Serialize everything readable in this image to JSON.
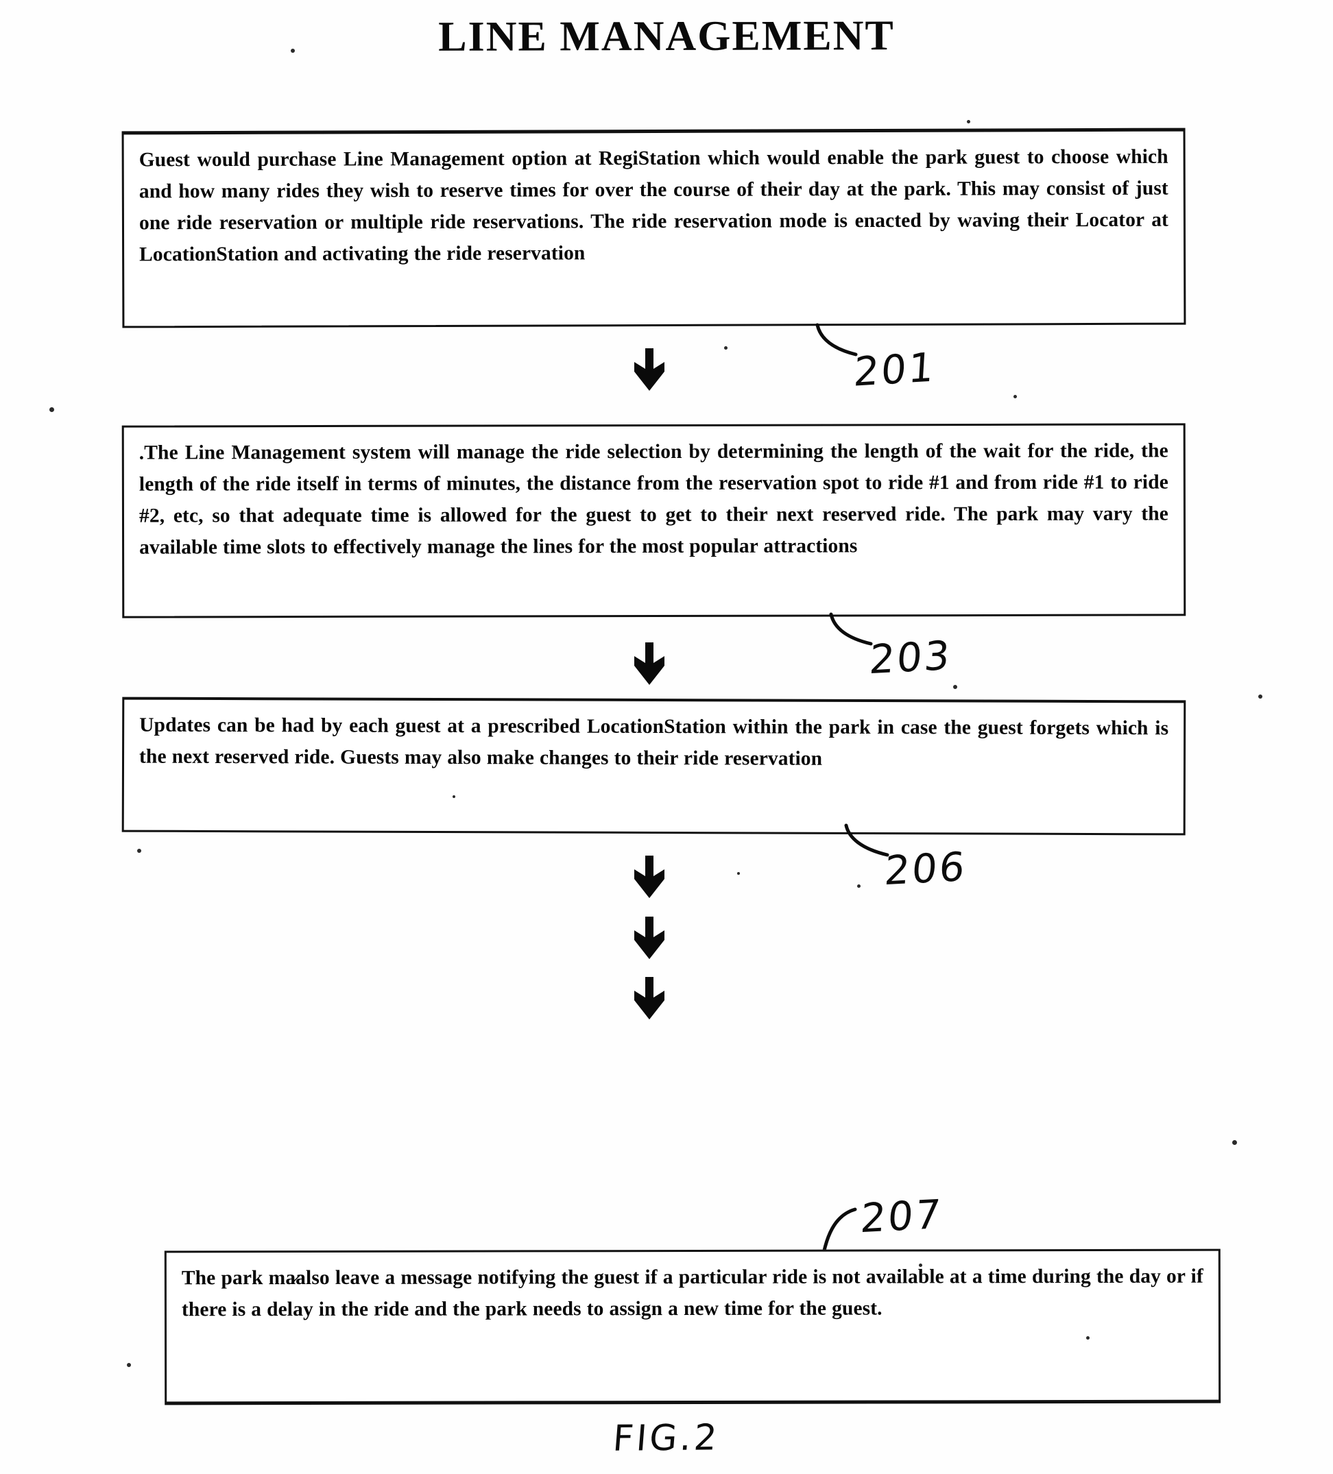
{
  "document": {
    "title": "LINE MANAGEMENT",
    "figure_caption": "FIG.2",
    "type": "patent-flowchart"
  },
  "flow": {
    "steps": [
      {
        "ref": "201",
        "text": "Guest would purchase Line Management option at RegiStation which would enable the park guest to choose which and how many rides they wish to reserve times for over the course of their day at the park.  This may consist of just one ride reservation or multiple ride reservations. The ride reservation mode is enacted by waving their Locator at LocationStation and activating the ride reservation"
      },
      {
        "ref": "203",
        "text": ".The Line Management system will manage the ride selection by determining the length of the wait for the ride, the length of the ride itself in terms of minutes, the distance from the reservation spot to  ride #1 and from ride #1 to ride #2, etc, so that adequate time is allowed for the guest to get to their next reserved ride.  The park may vary the available time slots to effectively manage the lines for the most popular attractions"
      },
      {
        "ref": "206",
        "text": "Updates can be had by each guest at a prescribed LocationStation within the park in case the guest forgets which is the next reserved ride. Guests may also make changes to their ride reservation"
      },
      {
        "ref": "207",
        "text": "The park ma̷also leave a message notifying the guest if a particular ride is not available at a time during the day or if there is a delay in the ride and the park needs to assign a new time for the guest."
      }
    ],
    "connectors": [
      {
        "name": "arrow-1",
        "glyph": "down-arrow"
      },
      {
        "name": "arrow-2",
        "glyph": "down-arrow"
      },
      {
        "name": "arrow-3",
        "glyph": "down-arrow"
      },
      {
        "name": "arrow-4",
        "glyph": "down-arrow"
      },
      {
        "name": "arrow-5",
        "glyph": "down-arrow"
      }
    ]
  },
  "colors": {
    "ink": "#0a0a0a",
    "paper": "#ffffff",
    "border": "#111111"
  }
}
